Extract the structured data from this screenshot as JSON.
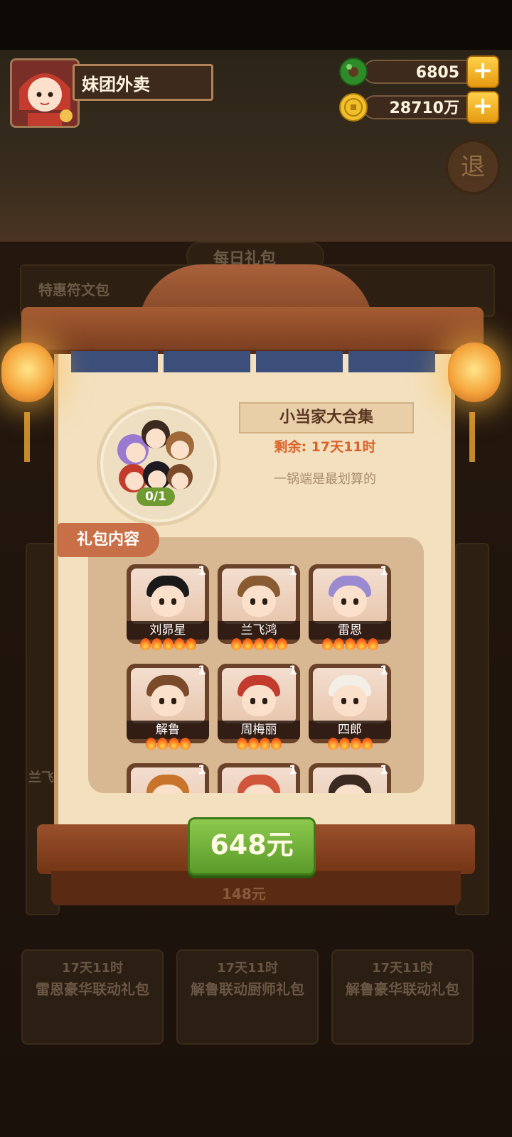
{
  "header": {
    "player_name": "妹团外卖",
    "jade": "6805",
    "coins": "28710万",
    "plus": "+"
  },
  "background": {
    "section_title": "每日礼包",
    "row1_title": "特惠符文包",
    "ghost_price": "148元",
    "ghost_name": "兰飞",
    "exit_label": "退",
    "bottom_cards": [
      {
        "timer": "17天11时",
        "name": "雷恩豪华联动礼包"
      },
      {
        "timer": "17天11时",
        "name": "解鲁联动厨师礼包"
      },
      {
        "timer": "17天11时",
        "name": "解鲁豪华联动礼包"
      }
    ]
  },
  "pack": {
    "title": "小当家大合集",
    "timer": "剩余: 17天11时",
    "slogan": "一锅端是最划算的",
    "progress": "0/1",
    "contents_label": "礼包内容",
    "price": "648元",
    "items": [
      {
        "name": "刘昴星",
        "count": "1",
        "stars": 5
      },
      {
        "name": "兰飞鸿",
        "count": "1",
        "stars": 5
      },
      {
        "name": "雷恩",
        "count": "1",
        "stars": 5
      },
      {
        "name": "解鲁",
        "count": "1",
        "stars": 4
      },
      {
        "name": "周梅丽",
        "count": "1",
        "stars": 4
      },
      {
        "name": "四郎",
        "count": "1",
        "stars": 4
      },
      {
        "name": "",
        "count": "1",
        "stars": 0
      },
      {
        "name": "",
        "count": "1",
        "stars": 0
      },
      {
        "name": "",
        "count": "1",
        "stars": 0
      }
    ]
  },
  "colors": {
    "accent": "#d9622a",
    "button_green": "#6aaa36",
    "paper": "#f3e0be"
  }
}
